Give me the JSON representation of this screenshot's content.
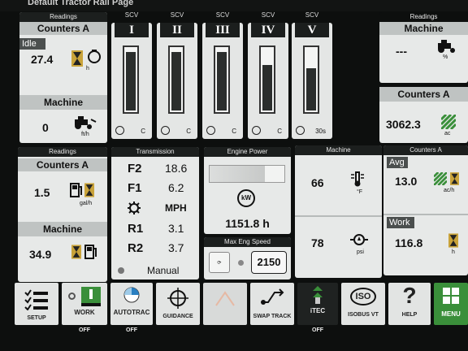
{
  "topbar": {
    "title": "Default Tractor Rail Page"
  },
  "readings_top": {
    "header": "Readings",
    "counters_title": "Counters A",
    "idle_label": "Idle",
    "idle_value": "27.4",
    "idle_unit": "h",
    "machine_title": "Machine",
    "machine_value": "0",
    "machine_unit": "ft/h"
  },
  "scv": [
    {
      "header": "SCV",
      "label": "I",
      "level": 0.95,
      "time": "C"
    },
    {
      "header": "SCV",
      "label": "II",
      "level": 0.95,
      "time": "C"
    },
    {
      "header": "SCV",
      "label": "III",
      "level": 0.95,
      "time": "C"
    },
    {
      "header": "SCV",
      "label": "IV",
      "level": 0.75,
      "time": "C"
    },
    {
      "header": "SCV",
      "label": "V",
      "level": 0.7,
      "time": "30s"
    }
  ],
  "readings_right": {
    "header": "Readings",
    "machine_title": "Machine",
    "machine_value": "---",
    "machine_unit": "%",
    "counters_title": "Counters A",
    "counters_value": "3062.3",
    "counters_unit": "ac"
  },
  "readings_mid": {
    "header": "Readings",
    "counters_title": "Counters A",
    "counters_value": "1.5",
    "counters_unit": "gal/h",
    "machine_title": "Machine",
    "machine_value": "34.9"
  },
  "transmission": {
    "header": "Transmission",
    "rows": [
      {
        "label": "F2",
        "value": "18.6"
      },
      {
        "label": "F1",
        "value": "6.2"
      },
      {
        "label": "",
        "value": "MPH"
      },
      {
        "label": "R1",
        "value": "3.1"
      },
      {
        "label": "R2",
        "value": "3.7"
      }
    ],
    "mode": "Manual"
  },
  "engine_power": {
    "header": "Engine Power",
    "value": "1151.8 h",
    "icon_text": "kW"
  },
  "max_eng_speed": {
    "header": "Max Eng Speed",
    "value": "2150"
  },
  "machine_mid": {
    "header": "Machine",
    "temp_value": "66",
    "temp_unit": "°F",
    "pressure_value": "78",
    "pressure_unit": "psi"
  },
  "counters_right": {
    "header": "Counters A",
    "avg_label": "Avg",
    "avg_value": "13.0",
    "avg_unit": "ac/h",
    "work_label": "Work",
    "work_value": "116.8",
    "work_unit": "h"
  },
  "bottom_bar": [
    {
      "label": "SETUP",
      "state": ""
    },
    {
      "label": "WORK",
      "state": "OFF"
    },
    {
      "label": "AUTOTRAC",
      "state": "OFF"
    },
    {
      "label": "GUIDANCE",
      "state": ""
    },
    {
      "label": "",
      "state": ""
    },
    {
      "label": "SWAP TRACK",
      "state": ""
    },
    {
      "label": "iTEC",
      "state": "OFF"
    },
    {
      "label": "ISOBUS VT",
      "state": ""
    },
    {
      "label": "HELP",
      "state": ""
    },
    {
      "label": "MENU",
      "state": ""
    }
  ],
  "colors": {
    "accent_green": "#3a8f3a",
    "panel": "#e7e9e8",
    "header": "#1c1f1e",
    "hourglass": "#c9a33a"
  }
}
